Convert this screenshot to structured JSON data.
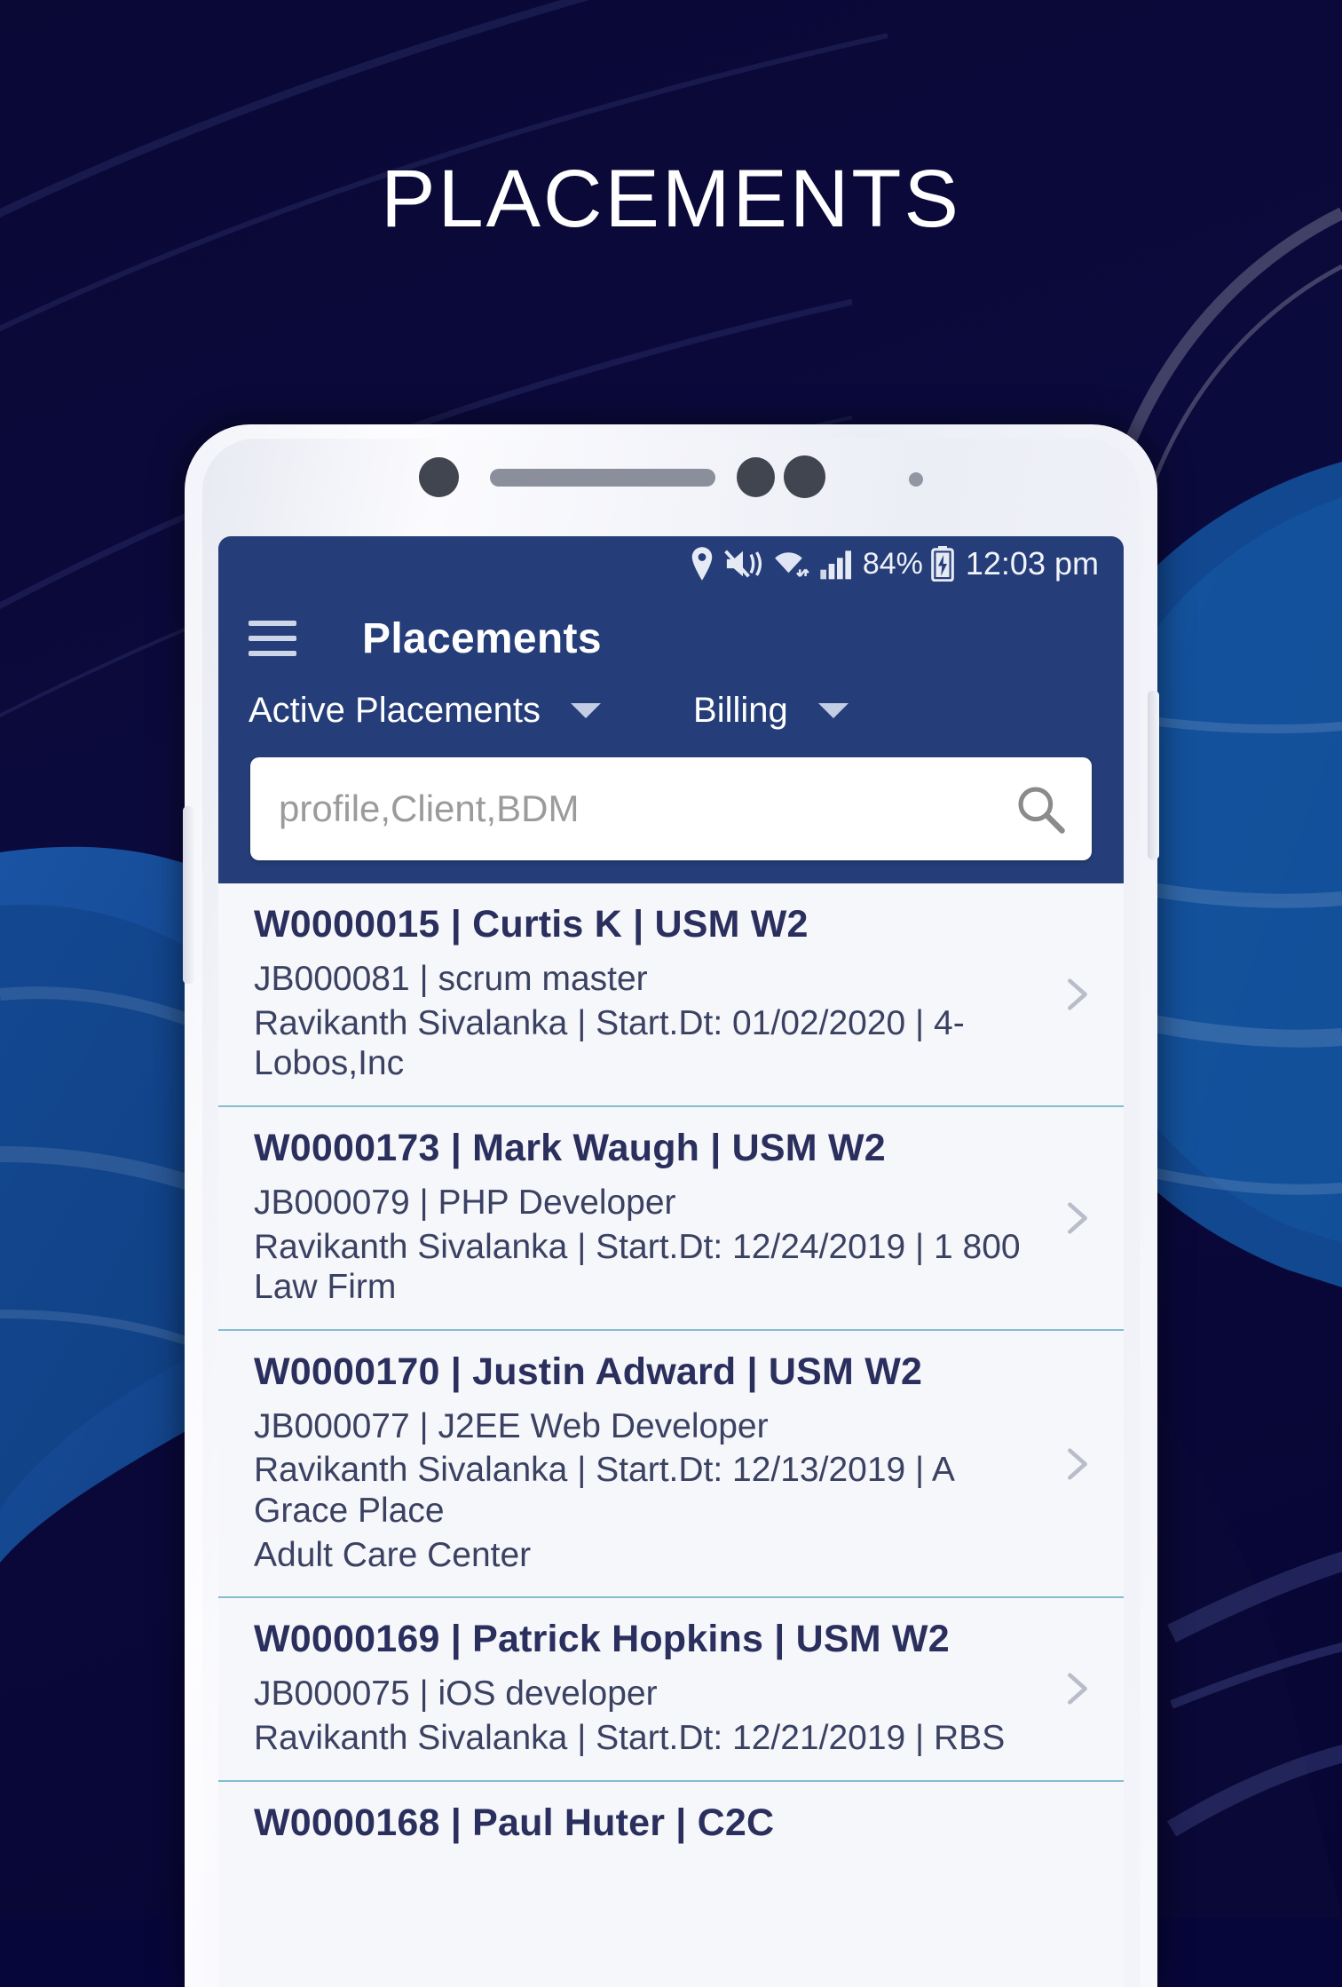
{
  "poster": {
    "title": "PLACEMENTS",
    "background_color": "#07063a",
    "accent_blue": "#14539f"
  },
  "phone": {
    "hardware": {
      "sensor": "proximity-sensor",
      "speaker": "earpiece-speaker",
      "camera_1": "front-camera",
      "camera_2": "front-camera-secondary",
      "dot": "led-indicator"
    }
  },
  "status_bar": {
    "icons": [
      "location-pin-icon",
      "mute-vibrate-icon",
      "wifi-icon",
      "signal-bars-icon"
    ],
    "battery_percent": "84%",
    "battery_state": "charging-battery-icon",
    "time": "12:03 pm"
  },
  "app_bar": {
    "menu_icon": "hamburger-menu-icon",
    "title": "Placements",
    "background_color": "#253d78",
    "filters": [
      {
        "label": "Active Placements",
        "caret": "chevron-down-icon"
      },
      {
        "label": "Billing",
        "caret": "chevron-down-icon"
      }
    ]
  },
  "search": {
    "placeholder": "profile,Client,BDM",
    "value": "",
    "icon": "search-icon"
  },
  "list": {
    "divider_color": "#85bcd0",
    "rows": [
      {
        "title": "W0000015 | Curtis K | USM W2",
        "lines": [
          "JB000081 | scrum master",
          "Ravikanth Sivalanka | Start.Dt: 01/02/2020 | 4-Lobos,Inc"
        ],
        "chevron": "chevron-right-icon"
      },
      {
        "title": "W0000173 | Mark Waugh | USM W2",
        "lines": [
          "JB000079 | PHP Developer",
          "Ravikanth Sivalanka | Start.Dt: 12/24/2019 | 1 800 Law Firm"
        ],
        "chevron": "chevron-right-icon"
      },
      {
        "title": "W0000170 | Justin Adward | USM W2",
        "lines": [
          "JB000077 | J2EE Web Developer",
          "Ravikanth Sivalanka | Start.Dt: 12/13/2019 | A Grace Place",
          "Adult Care Center"
        ],
        "chevron": "chevron-right-icon"
      },
      {
        "title": "W0000169 | Patrick Hopkins | USM W2",
        "lines": [
          "JB000075 | iOS developer",
          "Ravikanth Sivalanka | Start.Dt: 12/21/2019 | RBS"
        ],
        "chevron": "chevron-right-icon"
      },
      {
        "title": "W0000168 | Paul Huter | C2C",
        "lines": [],
        "chevron": "chevron-right-icon"
      }
    ]
  }
}
